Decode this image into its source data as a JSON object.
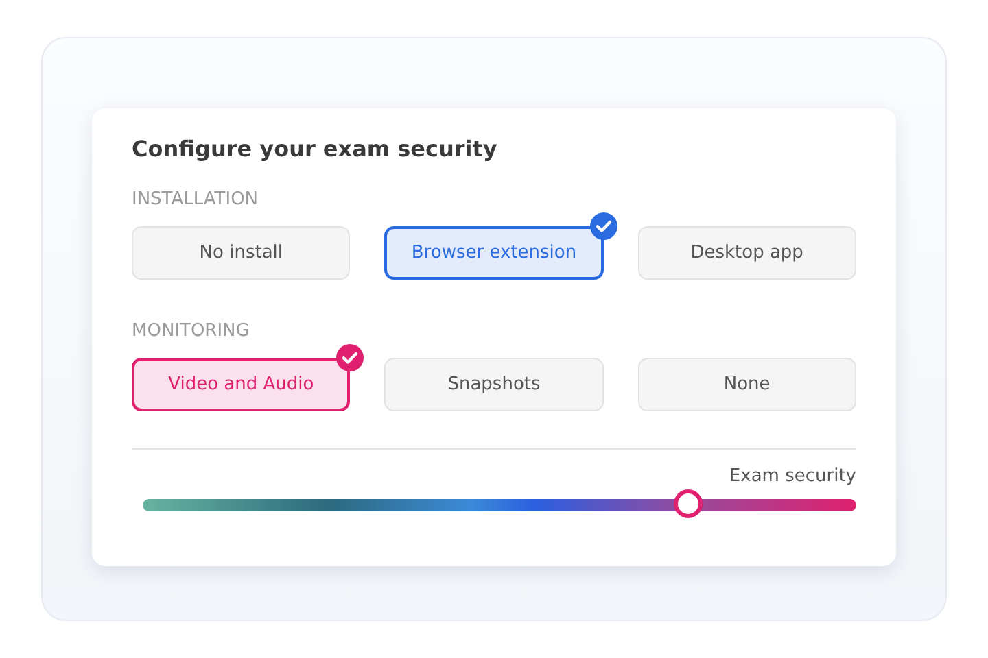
{
  "title": "Configure your exam security",
  "groups": [
    {
      "label": "INSTALLATION",
      "color": "#2b6be0",
      "options": [
        {
          "label": "No install",
          "selected": false
        },
        {
          "label": "Browser extension",
          "selected": true
        },
        {
          "label": "Desktop app",
          "selected": false
        }
      ]
    },
    {
      "label": "MONITORING",
      "color": "#e0206f",
      "options": [
        {
          "label": "Video and Audio",
          "selected": true
        },
        {
          "label": "Snapshots",
          "selected": false
        },
        {
          "label": "None",
          "selected": false
        }
      ]
    }
  ],
  "slider": {
    "label": "Exam security",
    "level": 0.765
  }
}
